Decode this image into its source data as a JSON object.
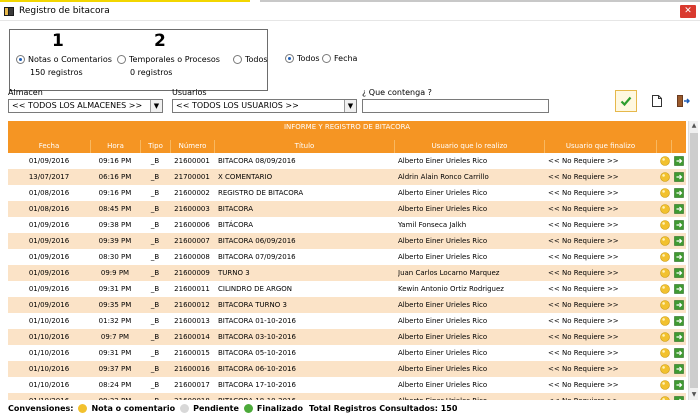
{
  "window": {
    "title": "Registro de bitacora",
    "close_glyph": "✕"
  },
  "filter": {
    "notas": {
      "big": "1",
      "label": "Notas o Comentarios",
      "count": "150 registros",
      "selected": true
    },
    "temporales": {
      "big": "2",
      "label": "Temporales o Procesos",
      "count": "0 registros",
      "selected": false
    },
    "todos_tipo": {
      "label": "Todos",
      "selected": false
    },
    "todos": {
      "label": "Todos",
      "selected": true
    },
    "fecha": {
      "label": "Fecha",
      "selected": false
    }
  },
  "almacen": {
    "label": "Almacen",
    "value": "<< TODOS LOS ALMACENES >>"
  },
  "usuarios": {
    "label": "Usuarios",
    "value": "<< TODOS LOS USUARIOS >>"
  },
  "contenga": {
    "label": "¿ Que contenga ?",
    "value": ""
  },
  "grid": {
    "caption": "INFORME Y REGISTRO DE BITACORA",
    "headers": [
      "Fecha",
      "Hora",
      "Tipo",
      "Número",
      "Título",
      "Usuario que lo realizo",
      "Usuario que finalizo"
    ],
    "rows": [
      [
        "01/09/2016",
        "09:16 PM",
        "_B",
        "21600001",
        "BITACORA 08/09/2016",
        "Alberto Einer Urieles Rico",
        "<< No Requiere >>"
      ],
      [
        "13/07/2017",
        "06:16 PM",
        "_B",
        "21700001",
        "X COMENTARIO",
        "Aldrin Alain Ronco Carrillo",
        "<< No Requiere >>"
      ],
      [
        "01/08/2016",
        "09:16 PM",
        "_B",
        "21600002",
        "REGISTRO DE BITACORA",
        "Alberto Einer Urieles Rico",
        "<< No Requiere >>"
      ],
      [
        "01/08/2016",
        "08:45 PM",
        "_B",
        "21600003",
        "BITACORA",
        "Alberto Einer Urieles Rico",
        "<< No Requiere >>"
      ],
      [
        "01/09/2016",
        "09:38 PM",
        "_B",
        "21600006",
        "BITÁCORA",
        "Yamil Fonseca Jalkh",
        "<< No Requiere >>"
      ],
      [
        "01/09/2016",
        "09:39 PM",
        "_B",
        "21600007",
        "BITACORA 06/09/2016",
        "Alberto Einer Urieles Rico",
        "<< No Requiere >>"
      ],
      [
        "01/09/2016",
        "08:30 PM",
        "_B",
        "21600008",
        "BITACORA 07/09/2016",
        "Alberto Einer Urieles Rico",
        "<< No Requiere >>"
      ],
      [
        "01/09/2016",
        "09:9 PM",
        "_B",
        "21600009",
        "TURNO 3",
        "Juan Carlos Locarno Marquez",
        "<< No Requiere >>"
      ],
      [
        "01/09/2016",
        "09:31 PM",
        "_B",
        "21600011",
        "CILINDRO DE ARGON",
        "Kewin Antonio Ortiz Rodriguez",
        "<< No Requiere >>"
      ],
      [
        "01/09/2016",
        "09:35 PM",
        "_B",
        "21600012",
        "BITACORA TURNO  3",
        "Alberto Einer Urieles Rico",
        "<< No Requiere >>"
      ],
      [
        "01/10/2016",
        "01:32 PM",
        "_B",
        "21600013",
        "BITACORA  01-10-2016",
        "Alberto Einer Urieles Rico",
        "<< No Requiere >>"
      ],
      [
        "01/10/2016",
        "09:7 PM",
        "_B",
        "21600014",
        "BITACORA 03-10-2016",
        "Alberto Einer Urieles Rico",
        "<< No Requiere >>"
      ],
      [
        "01/10/2016",
        "09:31 PM",
        "_B",
        "21600015",
        "BITACORA  05-10-2016",
        "Alberto Einer Urieles Rico",
        "<< No Requiere >>"
      ],
      [
        "01/10/2016",
        "09:37 PM",
        "_B",
        "21600016",
        "BITACORA 06-10-2016",
        "Alberto Einer Urieles Rico",
        "<< No Requiere >>"
      ],
      [
        "01/10/2016",
        "08:24 PM",
        "_B",
        "21600017",
        "BITACORA 17-10-2016",
        "Alberto Einer Urieles Rico",
        "<< No Requiere >>"
      ],
      [
        "01/10/2016",
        "09:32 PM",
        "_B",
        "21600018",
        "BITACORA 18-10-2016",
        "Alberto Einer Urieles Rico",
        "<< No Requiere >>"
      ]
    ]
  },
  "footer": {
    "prefix": "Convensiones:",
    "nota": "Nota o comentario",
    "pendiente": "Pendiente",
    "finalizado": "Finalizado",
    "total": "Total Registros Consultados: 150"
  },
  "colors": {
    "header": "#f59523",
    "row_alt": "#fbe3c7",
    "nota": "#f2c12e",
    "pendiente": "#d8d8d8",
    "finalizado": "#4caa3a"
  },
  "icons": {
    "app": "app-book-icon",
    "accept": "green-check-icon",
    "new": "new-document-icon",
    "exit": "exit-door-icon",
    "row_status": "yellow-ball-icon",
    "row_export": "green-export-icon"
  }
}
